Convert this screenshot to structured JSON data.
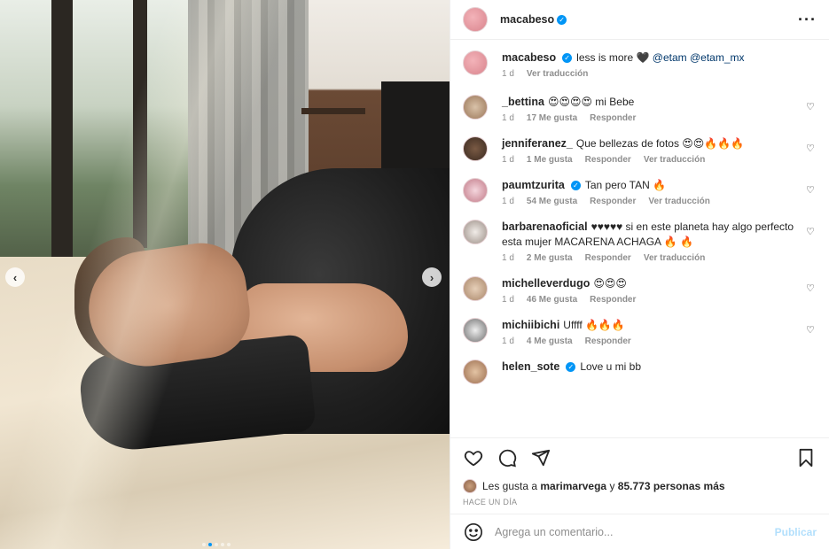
{
  "post": {
    "username": "macabeso",
    "caption_text": "less is more 🖤",
    "caption_tags": "@etam @etam_mx",
    "caption_time": "1 d",
    "caption_translate": "Ver traducción"
  },
  "comments": [
    {
      "user": "_bettina",
      "verified": false,
      "text": "😍😍😍😍 mi Bebe",
      "time": "1 d",
      "likes": "17 Me gusta",
      "reply": "Responder",
      "translate": ""
    },
    {
      "user": "jenniferanez_",
      "verified": false,
      "text": "Que bellezas de fotos 😍😍🔥🔥🔥",
      "time": "1 d",
      "likes": "1 Me gusta",
      "reply": "Responder",
      "translate": "Ver traducción"
    },
    {
      "user": "paumtzurita",
      "verified": true,
      "text": "Tan pero TAN 🔥",
      "time": "1 d",
      "likes": "54 Me gusta",
      "reply": "Responder",
      "translate": "Ver traducción"
    },
    {
      "user": "barbarenaoficial",
      "verified": false,
      "text": "♥♥♥♥♥ si en este planeta hay algo perfecto esta mujer MACARENA ACHAGA 🔥 🔥",
      "time": "1 d",
      "likes": "2 Me gusta",
      "reply": "Responder",
      "translate": "Ver traducción"
    },
    {
      "user": "michelleverdugo",
      "verified": false,
      "text": "😍😍😍",
      "time": "1 d",
      "likes": "46 Me gusta",
      "reply": "Responder",
      "translate": ""
    },
    {
      "user": "michiibichi",
      "verified": false,
      "text": "Uffff 🔥🔥🔥",
      "time": "1 d",
      "likes": "4 Me gusta",
      "reply": "Responder",
      "translate": ""
    },
    {
      "user": "helen_sote",
      "verified": true,
      "text": "Love u mi bb",
      "time": "",
      "likes": "",
      "reply": "",
      "translate": ""
    }
  ],
  "likes_line": {
    "prefix": "Les gusta a",
    "user": "marimarvega",
    "middle": "y",
    "count": "85.773 personas más"
  },
  "time_ago": "HACE UN DÍA",
  "composer": {
    "placeholder": "Agrega un comentario...",
    "publish": "Publicar"
  },
  "colors": {
    "accent": "#0095f6",
    "publish_disabled": "#b2dffc",
    "secondary_text": "#8e8e8e"
  },
  "icons": [
    "more-options-icon",
    "heart-icon",
    "comment-icon",
    "share-icon",
    "bookmark-icon",
    "emoji-icon",
    "verified-icon",
    "carousel-prev-icon",
    "carousel-next-icon"
  ]
}
